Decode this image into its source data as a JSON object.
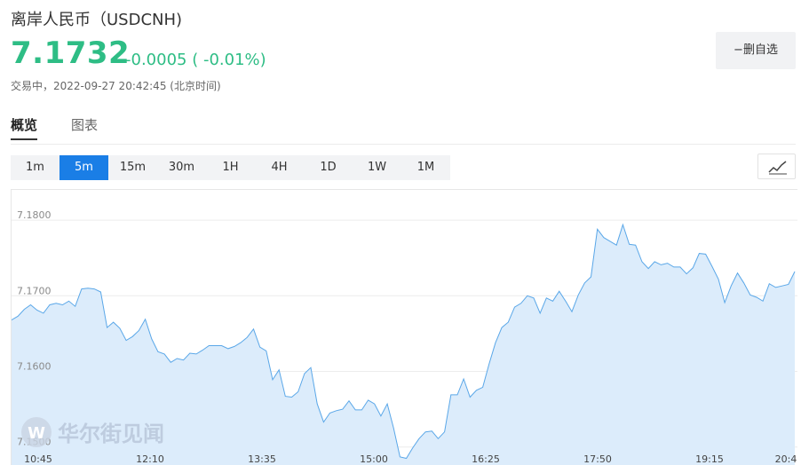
{
  "header": {
    "title": "离岸人民币（USDCNH)",
    "price": "7.1732",
    "change": "-0.0005",
    "change_pct": "( -0.01%)",
    "status": "交易中，2022-09-27 20:42:45 (北京时间)",
    "remove_label": "−删自选"
  },
  "tabs": [
    {
      "label": "概览",
      "active": true
    },
    {
      "label": "图表",
      "active": false
    }
  ],
  "periods": [
    {
      "label": "1m",
      "active": false
    },
    {
      "label": "5m",
      "active": true
    },
    {
      "label": "15m",
      "active": false
    },
    {
      "label": "30m",
      "active": false
    },
    {
      "label": "1H",
      "active": false
    },
    {
      "label": "4H",
      "active": false
    },
    {
      "label": "1D",
      "active": false
    },
    {
      "label": "1W",
      "active": false
    },
    {
      "label": "1M",
      "active": false
    }
  ],
  "chart_type_icon": "line-chart-icon",
  "watermark": "华尔街见闻",
  "colors": {
    "up_down_text": "#2ebd85",
    "active_period": "#1a7ee6",
    "line": "#5aa7e8",
    "area": "#dcecfb"
  },
  "chart_data": {
    "type": "area",
    "yticks": [
      "7.1800",
      "7.1700",
      "7.1600",
      "7.1500"
    ],
    "ylim": [
      7.1475,
      7.184
    ],
    "xticks": [
      "10:45",
      "12:10",
      "13:35",
      "15:00",
      "16:25",
      "17:50",
      "19:15",
      "20:4"
    ],
    "grid": "horizontal",
    "values": [
      7.1668,
      7.1673,
      7.1682,
      7.1688,
      7.1681,
      7.1677,
      7.1688,
      7.169,
      7.1688,
      7.1693,
      7.1686,
      7.1709,
      7.171,
      7.1709,
      7.1705,
      7.1658,
      7.1665,
      7.1657,
      7.1641,
      7.1646,
      7.1654,
      7.1669,
      7.1643,
      7.1626,
      7.1623,
      7.1612,
      7.1617,
      7.1615,
      7.1624,
      7.1623,
      7.1628,
      7.1634,
      7.1634,
      7.1634,
      7.163,
      7.1633,
      7.1638,
      7.1645,
      7.1656,
      7.1632,
      7.1627,
      7.1589,
      7.1602,
      7.1567,
      7.1566,
      7.1573,
      7.1597,
      7.1605,
      7.1557,
      7.1533,
      7.1545,
      7.1548,
      7.155,
      7.1561,
      7.1549,
      7.1549,
      7.1562,
      7.1557,
      7.1541,
      7.1557,
      7.1525,
      7.1487,
      7.1485,
      7.1499,
      7.1511,
      7.152,
      7.1521,
      7.1511,
      7.152,
      7.1569,
      7.1569,
      7.159,
      7.1566,
      7.1575,
      7.1579,
      7.161,
      7.1638,
      7.1658,
      7.1665,
      7.1685,
      7.169,
      7.17,
      7.1697,
      7.1677,
      7.1697,
      7.1693,
      7.1706,
      7.1693,
      7.1679,
      7.1701,
      7.1717,
      7.1725,
      7.1788,
      7.1777,
      7.1772,
      7.1767,
      7.1794,
      7.1768,
      7.1767,
      7.1745,
      7.1736,
      7.1745,
      7.1741,
      7.1743,
      7.1738,
      7.1738,
      7.1729,
      7.1737,
      7.1756,
      7.1755,
      7.1739,
      7.1722,
      7.1691,
      7.1713,
      7.173,
      7.1717,
      7.1701,
      7.1698,
      7.1693,
      7.1716,
      7.1711,
      7.1713,
      7.1715,
      7.1732
    ]
  }
}
